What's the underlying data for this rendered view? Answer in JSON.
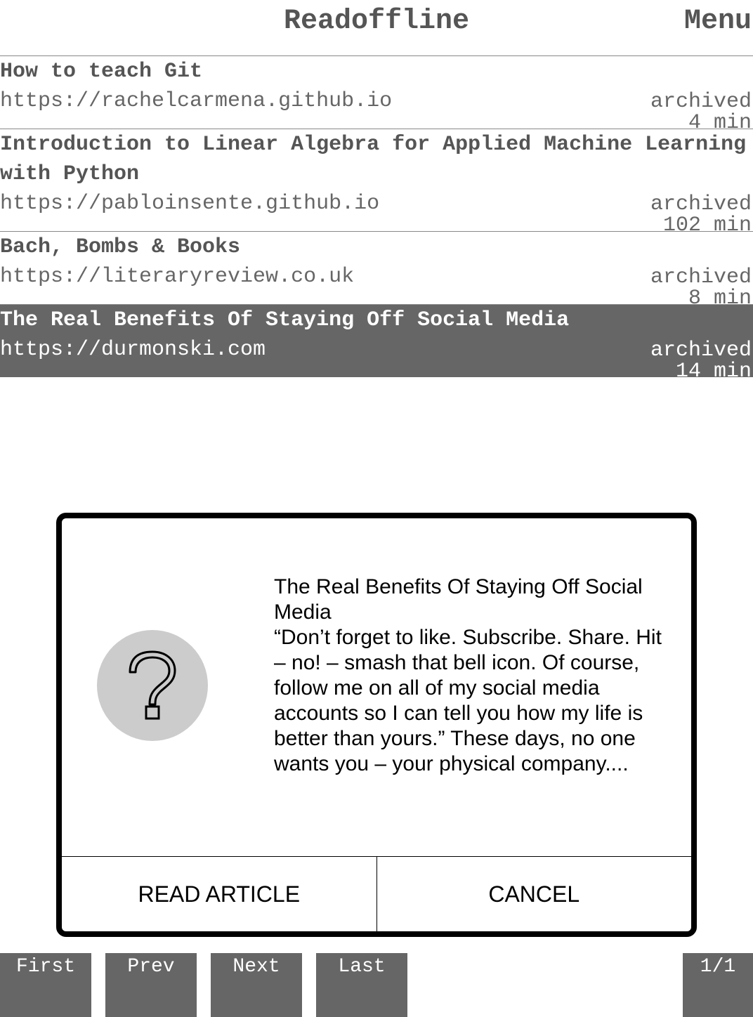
{
  "header": {
    "title": "Readoffline",
    "menu_label": "Menu"
  },
  "articles": [
    {
      "title": "How to teach Git",
      "url": "https://rachelcarmena.github.io",
      "status": "archived",
      "read_time": "4 min"
    },
    {
      "title": "Introduction to Linear Algebra for Applied Machine Learning with Python",
      "url": "https://pabloinsente.github.io",
      "status": "archived",
      "read_time": "102 min"
    },
    {
      "title": "Bach, Bombs & Books",
      "url": "https://literaryreview.co.uk",
      "status": "archived",
      "read_time": "8 min"
    },
    {
      "title": "The Real Benefits Of Staying Off Social Media",
      "url": "https://durmonski.com",
      "status": "archived",
      "read_time": "14 min",
      "selected": true
    }
  ],
  "dialog": {
    "icon": "question-mark-icon",
    "title": "The Real Benefits Of Staying Off Social Media",
    "excerpt": "“Don’t forget to like. Subscribe. Share. Hit – no! – smash that bell icon. Of course, follow me on all of my social media accounts so I can tell you how my life is better than yours.” These days, no one wants you – your physical company....",
    "read_button": "READ ARTICLE",
    "cancel_button": "CANCEL"
  },
  "pager": {
    "first": "First",
    "prev": "Prev",
    "next": "Next",
    "last": "Last",
    "page_indicator": "1/1"
  },
  "colors": {
    "selected_bg": "#666666",
    "text_gray": "#555555",
    "icon_circle": "#cccccc"
  }
}
